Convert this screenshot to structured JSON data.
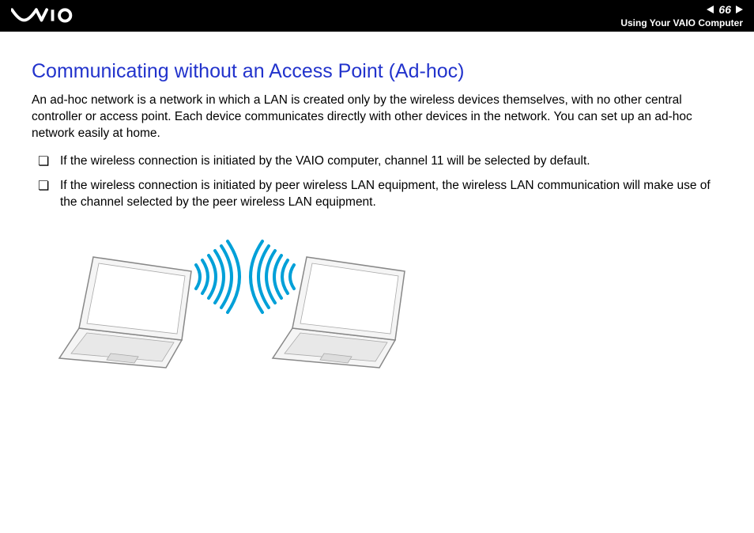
{
  "header": {
    "page_number": "66",
    "section": "Using Your VAIO Computer",
    "logo": "VAIO"
  },
  "title": "Communicating without an Access Point (Ad-hoc)",
  "intro": "An ad-hoc network is a network in which a LAN is created only by the wireless devices themselves, with no other central controller or access point. Each device communicates directly with other devices in the network. You can set up an ad-hoc network easily at home.",
  "bullets": [
    "If the wireless connection is initiated by the VAIO computer, channel 11 will be selected by default.",
    "If the wireless connection is initiated by peer wireless LAN equipment, the wireless LAN communication will make use of the channel selected by the peer wireless LAN equipment."
  ],
  "illustration": {
    "description": "two-laptops-wireless-adhoc"
  }
}
